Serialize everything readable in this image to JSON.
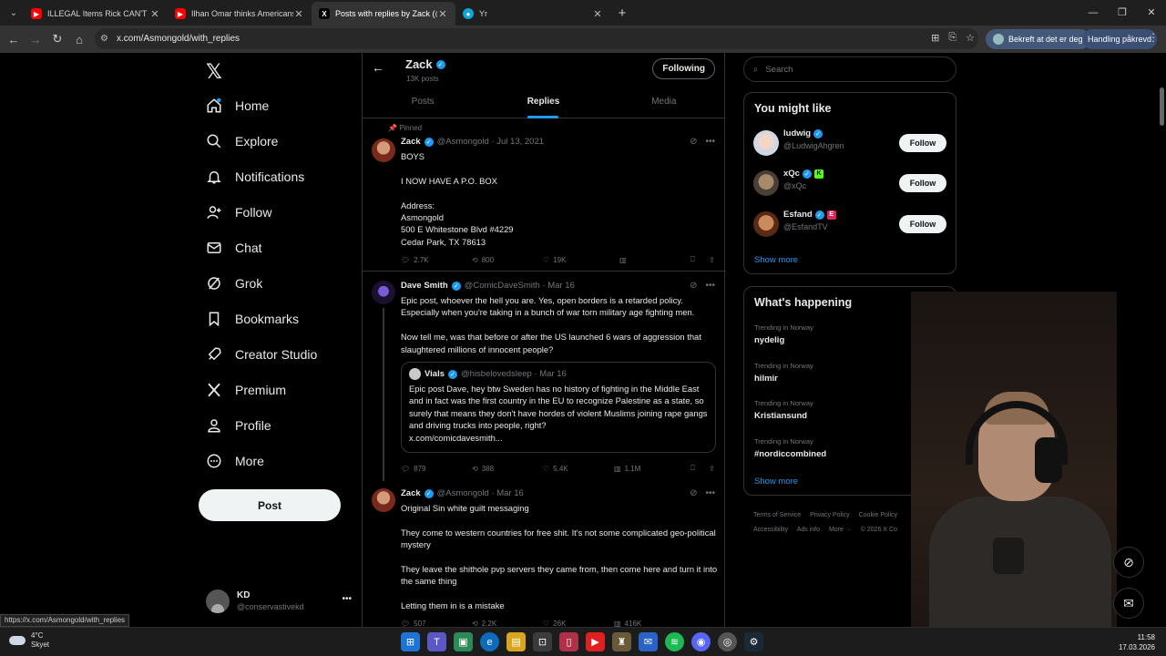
{
  "browser": {
    "tabs": [
      {
        "title": "ILLEGAL Items Rick CAN'T HAVE",
        "icon": "youtube-icon",
        "color": "#ff0000"
      },
      {
        "title": "Ilhan Omar thinks Americans are",
        "icon": "youtube-icon",
        "color": "#ff0000"
      },
      {
        "title": "Posts with replies by Zack (@Asmongold)",
        "icon": "x-icon",
        "color": "#000000"
      },
      {
        "title": "Yr",
        "icon": "yr-icon",
        "color": "#0ea5d8"
      }
    ],
    "url": "x.com/Asmongold/with_replies",
    "profile_pill": "Bekreft at det er deg",
    "action_pill": "Handling påkrevd",
    "status_url": "https://x.com/Asmongold/with_replies"
  },
  "nav": {
    "items": [
      "Home",
      "Explore",
      "Notifications",
      "Follow",
      "Chat",
      "Grok",
      "Bookmarks",
      "Creator Studio",
      "Premium",
      "Profile",
      "More"
    ],
    "post_label": "Post",
    "account": {
      "name": "KD",
      "handle": "@conservastivekd"
    }
  },
  "profile": {
    "name": "Zack",
    "posts_count": "13K posts",
    "following_label": "Following",
    "tabs": [
      "Posts",
      "Replies",
      "Media"
    ],
    "active_tab": "Replies"
  },
  "tweets": [
    {
      "pinned": "Pinned",
      "name": "Zack",
      "handle": "@Asmongold · Jul 13, 2021",
      "text": "BOYS\n\nI NOW HAVE A P.O. BOX\n\nAddress:\nAsmongold\n500 E Whitestone Blvd #4229\nCedar Park, TX 78613",
      "replies": "2.7K",
      "reposts": "800",
      "likes": "19K"
    },
    {
      "name": "Dave Smith",
      "handle": "@ComicDaveSmith · Mar 16",
      "text": "Epic post, whoever the hell you are. Yes, open borders is a retarded policy. Especially when you're taking in a bunch of war torn military age fighting men.\n\nNow tell me, was that before or after the US launched 6 wars of aggression that slaughtered millions of innocent people?",
      "quote": {
        "name": "Vials",
        "handle": "@hisbelovedsleep · Mar 16",
        "text": "Epic post Dave, hey btw Sweden has no history of fighting in the Middle East and in fact was the first country in the EU to recognize Palestine as a state, so surely that means they don't have hordes of violent Muslims joining rape gangs and driving trucks into people, right?\nx.com/comicdavesmith..."
      },
      "replies": "879",
      "reposts": "388",
      "likes": "5.4K",
      "views": "1.1M"
    },
    {
      "name": "Zack",
      "handle": "@Asmongold · Mar 16",
      "text": "Original Sin white guilt messaging\n\nThey come to western countries for free shit. It's not some complicated geo-political mystery\n\nThey leave the shithole pvp servers they came from, then come here and turn it into the same thing\n\nLetting them in is a mistake",
      "replies": "507",
      "reposts": "2.2K",
      "likes": "26K",
      "views": "416K"
    }
  ],
  "right": {
    "search_placeholder": "Search",
    "might_like_title": "You might like",
    "suggestions": [
      {
        "name": "ludwig",
        "handle": "@LudwigAhgren",
        "badge": ""
      },
      {
        "name": "xQc",
        "handle": "@xQc",
        "badge": "K"
      },
      {
        "name": "Esfand",
        "handle": "@EsfandTV",
        "badge": "E"
      }
    ],
    "follow_label": "Follow",
    "show_more": "Show more",
    "happening_title": "What's happening",
    "trends": [
      {
        "label": "Trending in Norway",
        "name": "nydelig"
      },
      {
        "label": "Trending in Norway",
        "name": "hilmir"
      },
      {
        "label": "Trending in Norway",
        "name": "Kristiansund"
      },
      {
        "label": "Trending in Norway",
        "name": "#nordiccombined"
      }
    ],
    "footer": [
      "Terms of Service",
      "Privacy Policy",
      "Cookie Policy",
      "Accessibility",
      "Ads info",
      "More ···",
      "© 2026 X Co"
    ]
  },
  "taskbar": {
    "temp": "4°C",
    "weather": "Skyet",
    "time": "11:58",
    "date": "17.03.2026"
  }
}
